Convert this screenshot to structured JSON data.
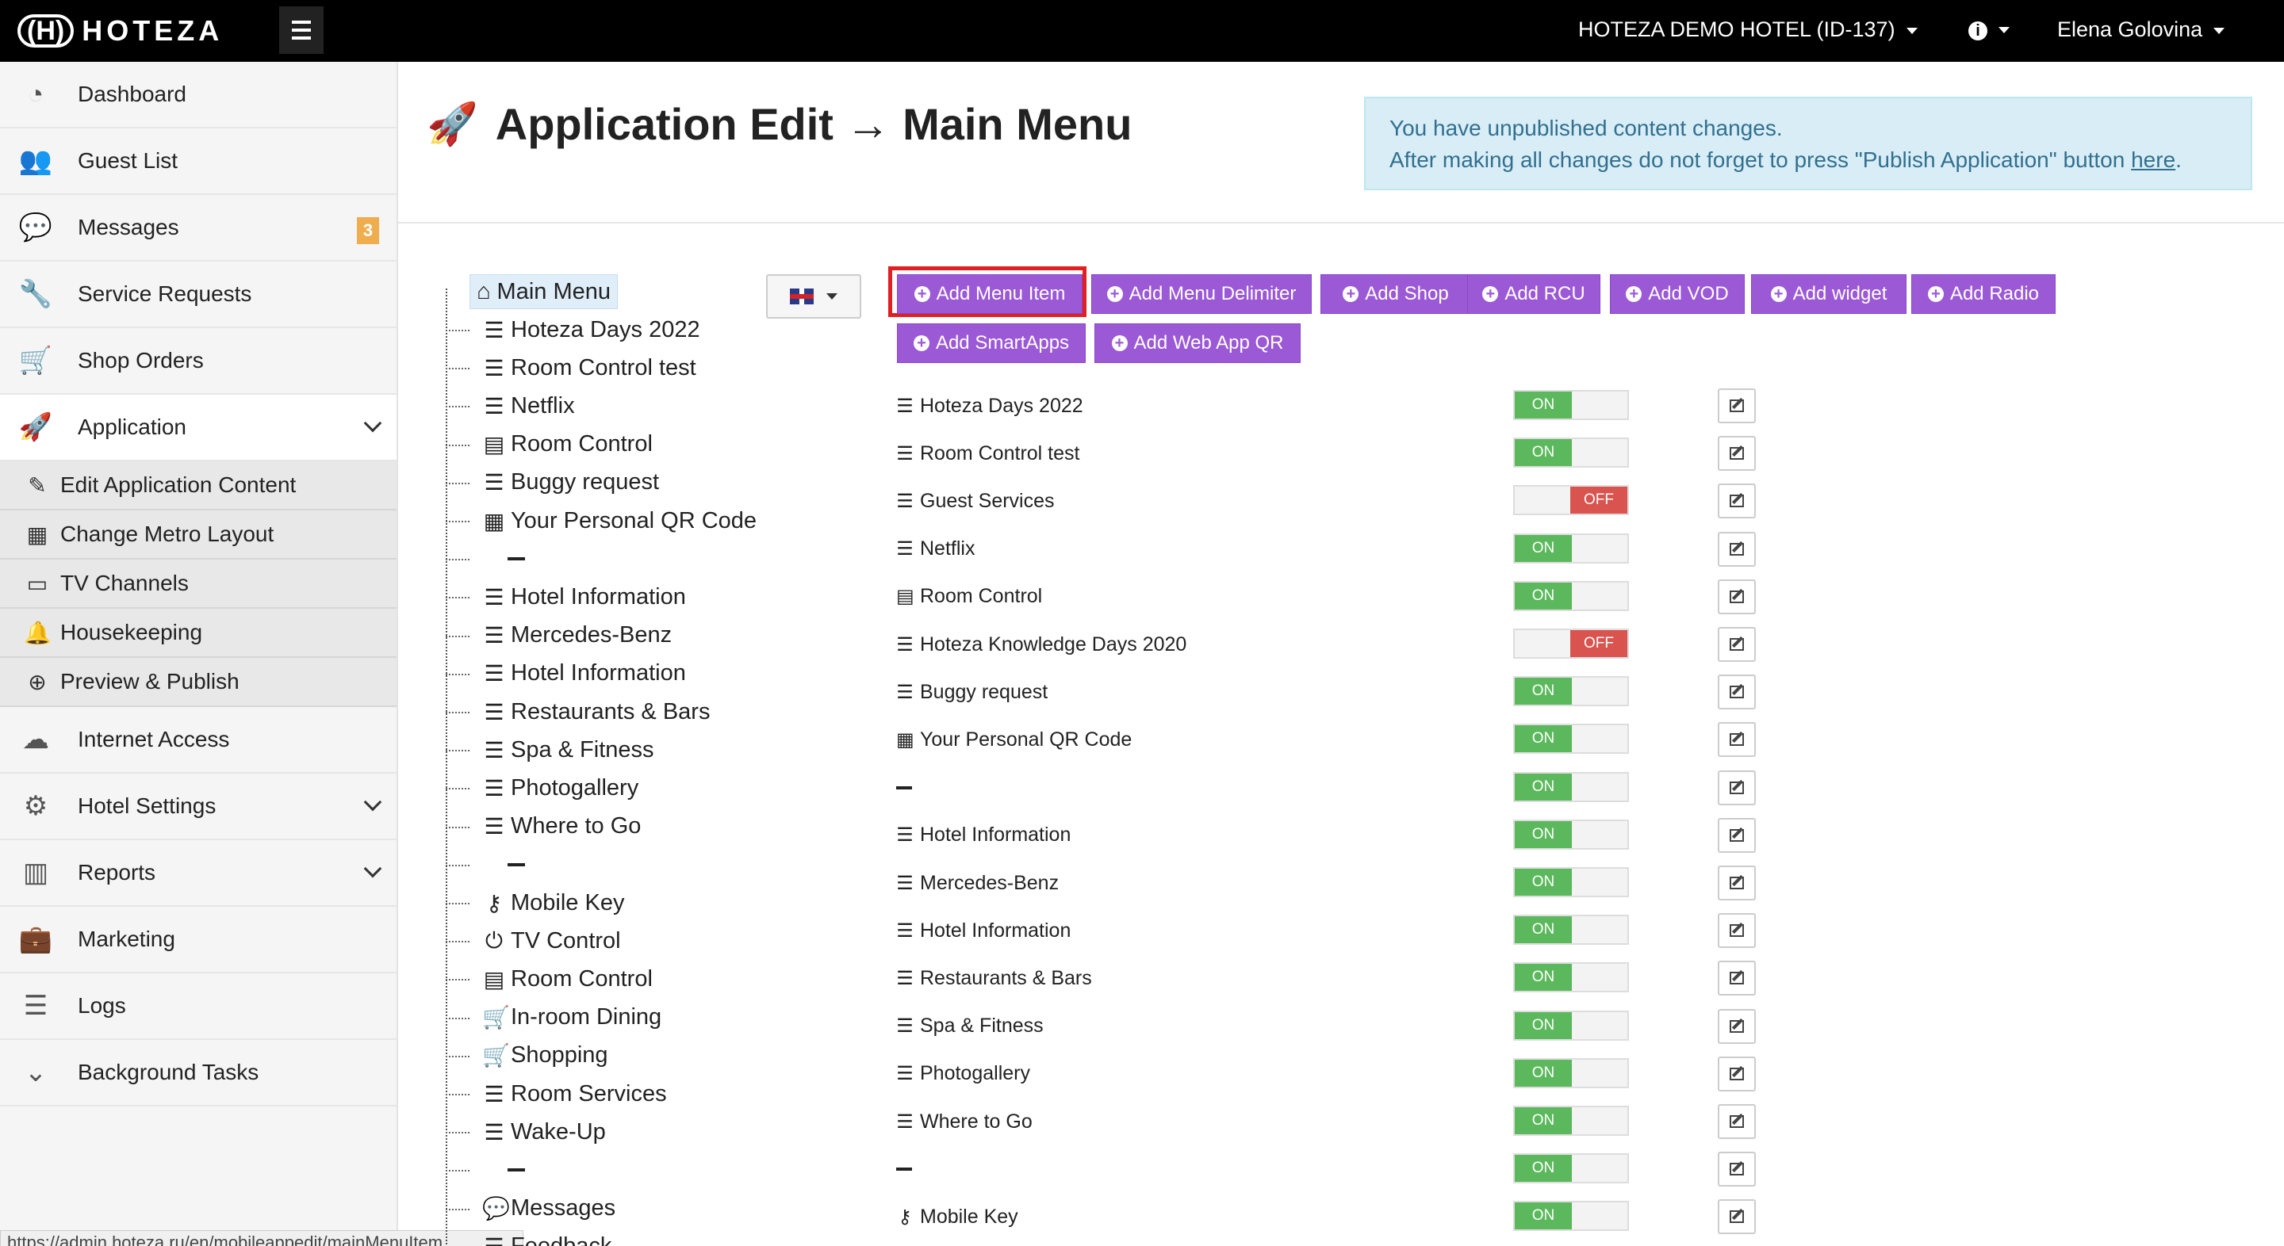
{
  "topbar": {
    "logo_mark": "(H)",
    "logo_text": "HOTEZA",
    "hotel": "HOTEZA DEMO HOTEL (ID-137)",
    "info_icon": "i",
    "user": "Elena Golovina"
  },
  "sidebar": {
    "items": [
      {
        "label": "Dashboard",
        "icon": "dashboard-icon"
      },
      {
        "label": "Guest List",
        "icon": "users-icon"
      },
      {
        "label": "Messages",
        "icon": "comments-icon",
        "badge": "3"
      },
      {
        "label": "Service Requests",
        "icon": "wrench-icon"
      },
      {
        "label": "Shop Orders",
        "icon": "cart-icon"
      },
      {
        "label": "Application",
        "icon": "rocket-icon"
      },
      {
        "label": "Internet Access",
        "icon": "cloud-icon"
      },
      {
        "label": "Hotel Settings",
        "icon": "cogs-icon"
      },
      {
        "label": "Reports",
        "icon": "bar-chart-icon"
      },
      {
        "label": "Marketing",
        "icon": "briefcase-icon"
      },
      {
        "label": "Logs",
        "icon": "list-icon"
      },
      {
        "label": "Background Tasks",
        "icon": "double-chevron-icon"
      }
    ],
    "sub_items": [
      {
        "label": "Edit Application Content",
        "icon": "edit-icon"
      },
      {
        "label": "Change Metro Layout",
        "icon": "grid-icon"
      },
      {
        "label": "TV Channels",
        "icon": "monitor-icon"
      },
      {
        "label": "Housekeeping",
        "icon": "bell-icon"
      },
      {
        "label": "Preview & Publish",
        "icon": "search-plus-icon"
      }
    ]
  },
  "status_url": "https://admin.hoteza.ru/en/mobileappedit/mainMenuItem",
  "page": {
    "title": "Application Edit → Main Menu"
  },
  "alert": {
    "line1": "You have unpublished content changes.",
    "line2_prefix": "After making all changes do not forget to press \"Publish Application\" button ",
    "link": "here",
    "line2_suffix": "."
  },
  "tree": {
    "root": "Main Menu",
    "items": [
      {
        "label": "Hoteza Days 2022",
        "icon": "☰"
      },
      {
        "label": "Room Control test",
        "icon": "☰"
      },
      {
        "label": "Netflix",
        "icon": "☰"
      },
      {
        "label": "Room Control",
        "icon": "▤"
      },
      {
        "label": "Buggy request",
        "icon": "☰"
      },
      {
        "label": "Your Personal QR Code",
        "icon": "▦"
      },
      {
        "label": "",
        "icon": "",
        "delim": true
      },
      {
        "label": "Hotel Information",
        "icon": "☰"
      },
      {
        "label": "Mercedes-Benz",
        "icon": "☰"
      },
      {
        "label": "Hotel Information",
        "icon": "☰"
      },
      {
        "label": "Restaurants & Bars",
        "icon": "☰"
      },
      {
        "label": "Spa & Fitness",
        "icon": "☰"
      },
      {
        "label": "Photogallery",
        "icon": "☰"
      },
      {
        "label": "Where to Go",
        "icon": "☰"
      },
      {
        "label": "",
        "icon": "",
        "delim": true
      },
      {
        "label": "Mobile Key",
        "icon": "⚷"
      },
      {
        "label": "TV Control",
        "icon": "⏻"
      },
      {
        "label": "Room Control",
        "icon": "▤"
      },
      {
        "label": "In-room Dining",
        "icon": "🛒"
      },
      {
        "label": "Shopping",
        "icon": "🛒"
      },
      {
        "label": "Room Services",
        "icon": "☰"
      },
      {
        "label": "Wake-Up",
        "icon": "☰"
      },
      {
        "label": "",
        "icon": "",
        "delim": true
      },
      {
        "label": "Messages",
        "icon": "💬"
      },
      {
        "label": "Feedback",
        "icon": "☰"
      }
    ]
  },
  "actions": [
    "Add Menu Item",
    "Add Menu Delimiter",
    "Add Shop",
    "Add RCU",
    "Add VOD",
    "Add widget",
    "Add Radio",
    "Add SmartApps",
    "Add Web App QR"
  ],
  "toggle_labels": {
    "on": "ON",
    "off": "OFF"
  },
  "menu_rows": [
    {
      "label": "Hoteza Days 2022",
      "icon": "☰",
      "state": "on"
    },
    {
      "label": "Room Control test",
      "icon": "☰",
      "state": "on"
    },
    {
      "label": "Guest Services",
      "icon": "☰",
      "state": "off"
    },
    {
      "label": "Netflix",
      "icon": "☰",
      "state": "on"
    },
    {
      "label": "Room Control",
      "icon": "▤",
      "state": "on"
    },
    {
      "label": "Hoteza Knowledge Days 2020",
      "icon": "☰",
      "state": "off"
    },
    {
      "label": "Buggy request",
      "icon": "☰",
      "state": "on"
    },
    {
      "label": "Your Personal QR Code",
      "icon": "▦",
      "state": "on"
    },
    {
      "label": "",
      "icon": "",
      "delim": true,
      "state": "on"
    },
    {
      "label": "Hotel Information",
      "icon": "☰",
      "state": "on"
    },
    {
      "label": "Mercedes-Benz",
      "icon": "☰",
      "state": "on"
    },
    {
      "label": "Hotel Information",
      "icon": "☰",
      "state": "on"
    },
    {
      "label": "Restaurants & Bars",
      "icon": "☰",
      "state": "on"
    },
    {
      "label": "Spa & Fitness",
      "icon": "☰",
      "state": "on"
    },
    {
      "label": "Photogallery",
      "icon": "☰",
      "state": "on"
    },
    {
      "label": "Where to Go",
      "icon": "☰",
      "state": "on"
    },
    {
      "label": "",
      "icon": "",
      "delim": true,
      "state": "on"
    },
    {
      "label": "Mobile Key",
      "icon": "⚷",
      "state": "on"
    }
  ]
}
